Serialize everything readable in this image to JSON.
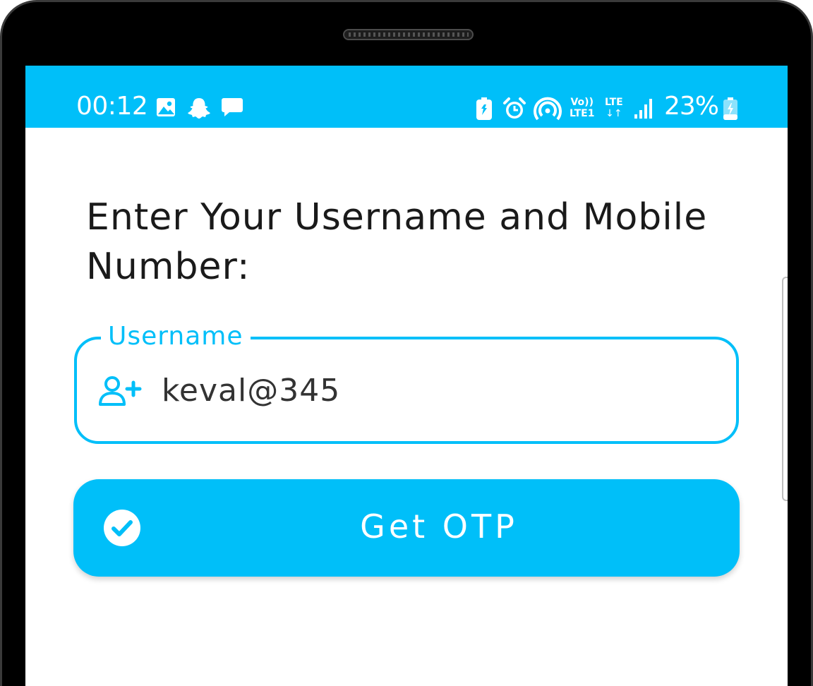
{
  "status_bar": {
    "time": "00:12",
    "battery_percent": "23%",
    "volte_top": "Vo))",
    "volte_bottom": "LTE1",
    "lte_label": "LTE",
    "lte_arrows": "↓↑",
    "left_icons": [
      "gallery-icon",
      "snapchat-icon",
      "message-icon"
    ],
    "right_icons": [
      "battery-saver-icon",
      "alarm-icon",
      "hotspot-icon",
      "signal-icon",
      "battery-charging-icon"
    ]
  },
  "page": {
    "heading": "Enter Your Username and Mobile Number:"
  },
  "username_field": {
    "label": "Username",
    "value": "keval@345",
    "icon": "add-user-icon"
  },
  "otp_button": {
    "label": "Get OTP",
    "icon": "check-circle-icon"
  },
  "colors": {
    "accent": "#00bff9",
    "bezel": "#000000",
    "text": "#1a1a1a"
  }
}
